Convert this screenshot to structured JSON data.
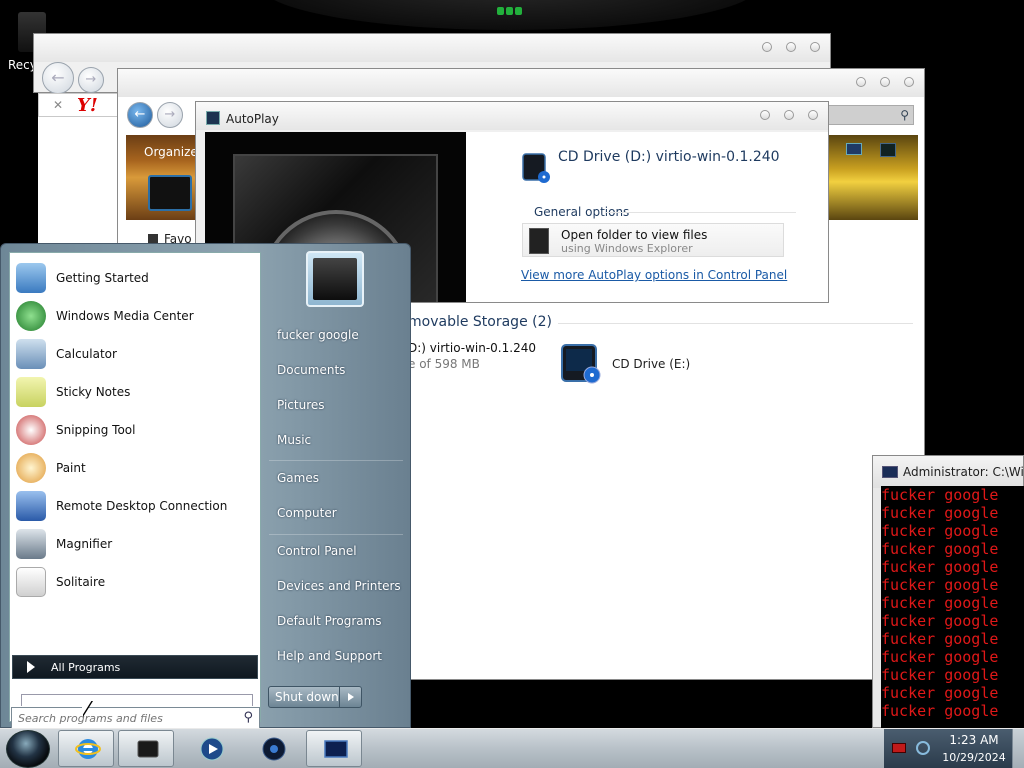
{
  "desktop": {
    "recycle_bin_label": "Recyc"
  },
  "autoplay": {
    "title": "AutoPlay",
    "drive_label": "CD Drive (D:) virtio-win-0.1.240",
    "general_options": "General options",
    "option_title": "Open folder to view files",
    "option_subtitle": "using Windows Explorer",
    "more_link": "View more AutoPlay options in Control Panel"
  },
  "explorer": {
    "organize_label": "Organize",
    "favorites_label": "Favo",
    "section_header": "movable Storage (2)",
    "device1_name": "D:) virtio-win-0.1.240",
    "device1_size": "e of 598 MB",
    "device2_name": "CD Drive (E:)"
  },
  "cmd": {
    "title": "Administrator: C:\\Wind",
    "lines": [
      "fucker google",
      "fucker google",
      "fucker google",
      "fucker google",
      "fucker google",
      "fucker google",
      "fucker google",
      "fucker google",
      "fucker google",
      "fucker google",
      "fucker google",
      "fucker google",
      "fucker google"
    ]
  },
  "start_menu": {
    "programs": [
      {
        "label": "Getting Started",
        "icon": "getting-started-icon",
        "color": "#4a8ac8"
      },
      {
        "label": "Windows Media Center",
        "icon": "windows-media-center-icon",
        "color": "#3a9a3a"
      },
      {
        "label": "Calculator",
        "icon": "calculator-icon",
        "color": "#6a8fb8"
      },
      {
        "label": "Sticky Notes",
        "icon": "sticky-notes-icon",
        "color": "#d8e27a"
      },
      {
        "label": "Snipping Tool",
        "icon": "snipping-tool-icon",
        "color": "#c84848"
      },
      {
        "label": "Paint",
        "icon": "paint-icon",
        "color": "#e09a3a"
      },
      {
        "label": "Remote Desktop Connection",
        "icon": "remote-desktop-icon",
        "color": "#3a6ab8"
      },
      {
        "label": "Magnifier",
        "icon": "magnifier-icon",
        "color": "#6a7a8a"
      },
      {
        "label": "Solitaire",
        "icon": "solitaire-icon",
        "color": "#f2f2f2"
      }
    ],
    "all_programs": "All Programs",
    "search_placeholder": "Search programs and files",
    "right_items": [
      "fucker google",
      "Documents",
      "Pictures",
      "Music",
      "Games",
      "Computer",
      "Control Panel",
      "Devices and Printers",
      "Default Programs",
      "Help and Support"
    ],
    "shutdown_label": "Shut down"
  },
  "taskbar": {
    "time": "1:23 AM",
    "date": "10/29/2024"
  }
}
